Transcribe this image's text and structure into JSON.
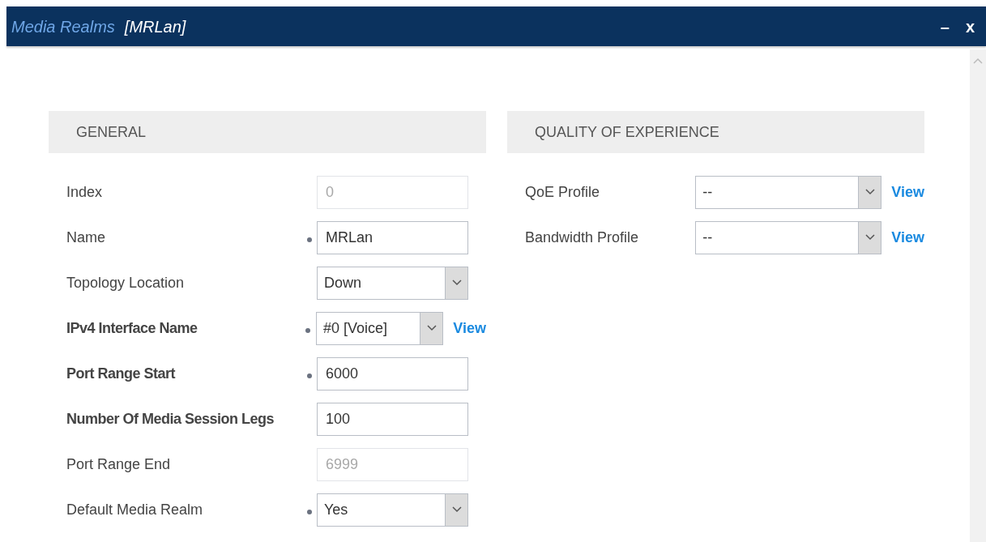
{
  "window": {
    "title": "Media Realms",
    "subtitle": "[MRLan]",
    "controls": [
      "–",
      "x"
    ]
  },
  "sections": [
    {
      "title": "GENERAL",
      "fields": [
        {
          "label": "Index",
          "kind": "text",
          "value": "0",
          "bold": false,
          "modified": false,
          "disabled": true
        },
        {
          "label": "Name",
          "kind": "text",
          "value": "MRLan",
          "bold": false,
          "modified": true,
          "disabled": false
        },
        {
          "label": "Topology Location",
          "kind": "select",
          "value": "Down",
          "bold": false,
          "modified": false,
          "disabled": false
        },
        {
          "label": "IPv4 Interface Name",
          "kind": "select",
          "value": "#0 [Voice]",
          "bold": true,
          "modified": true,
          "disabled": false,
          "link": "View"
        },
        {
          "label": "Port Range Start",
          "kind": "text",
          "value": "6000",
          "bold": true,
          "modified": true,
          "disabled": false
        },
        {
          "label": "Number Of Media Session Legs",
          "kind": "text",
          "value": "100",
          "bold": true,
          "modified": false,
          "disabled": false
        },
        {
          "label": "Port Range End",
          "kind": "text",
          "value": "6999",
          "bold": false,
          "modified": false,
          "disabled": true
        },
        {
          "label": "Default Media Realm",
          "kind": "select",
          "value": "Yes",
          "bold": false,
          "modified": true,
          "disabled": false
        }
      ]
    },
    {
      "title": "QUALITY OF EXPERIENCE",
      "fields": [
        {
          "label": "QoE Profile",
          "kind": "select",
          "value": "--",
          "bold": false,
          "modified": false,
          "disabled": false,
          "link": "View"
        },
        {
          "label": "Bandwidth Profile",
          "kind": "select",
          "value": "--",
          "bold": false,
          "modified": false,
          "disabled": false,
          "link": "View"
        }
      ]
    }
  ]
}
